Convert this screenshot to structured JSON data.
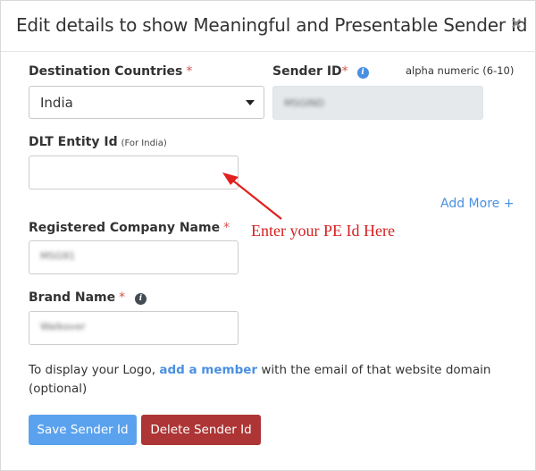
{
  "dialog": {
    "title": "Edit details to show Meaningful and Presentable Sender Id",
    "close_label": "×"
  },
  "fields": {
    "destination": {
      "label": "Destination Countries",
      "required_mark": "*",
      "value": "India"
    },
    "sender_id": {
      "label": "Sender ID",
      "required_mark": "*",
      "info_icon": "info-icon",
      "hint": "alpha numeric (6-10)",
      "value": "MSGIND"
    },
    "dlt_entity": {
      "label": "DLT Entity Id",
      "note": "(For India)",
      "value": ""
    },
    "add_more": "Add More +",
    "company_name": {
      "label": "Registered Company Name",
      "required_mark": "*",
      "value": "MSG91"
    },
    "brand_name": {
      "label": "Brand Name",
      "required_mark": "*",
      "info_icon": "info-icon",
      "value": "Walkover"
    }
  },
  "annotation": {
    "text": "Enter your PE Id Here",
    "color": "#d62020"
  },
  "logo_note": {
    "before": "To display your Logo, ",
    "link": "add a member",
    "after": " with the email of that website domain (optional)"
  },
  "buttons": {
    "save": "Save Sender Id",
    "delete": "Delete Sender Id"
  },
  "colors": {
    "accent": "#4a90e2",
    "save_button": "#5aa2ee",
    "delete_button": "#ad3535",
    "required": "#d9534f"
  }
}
